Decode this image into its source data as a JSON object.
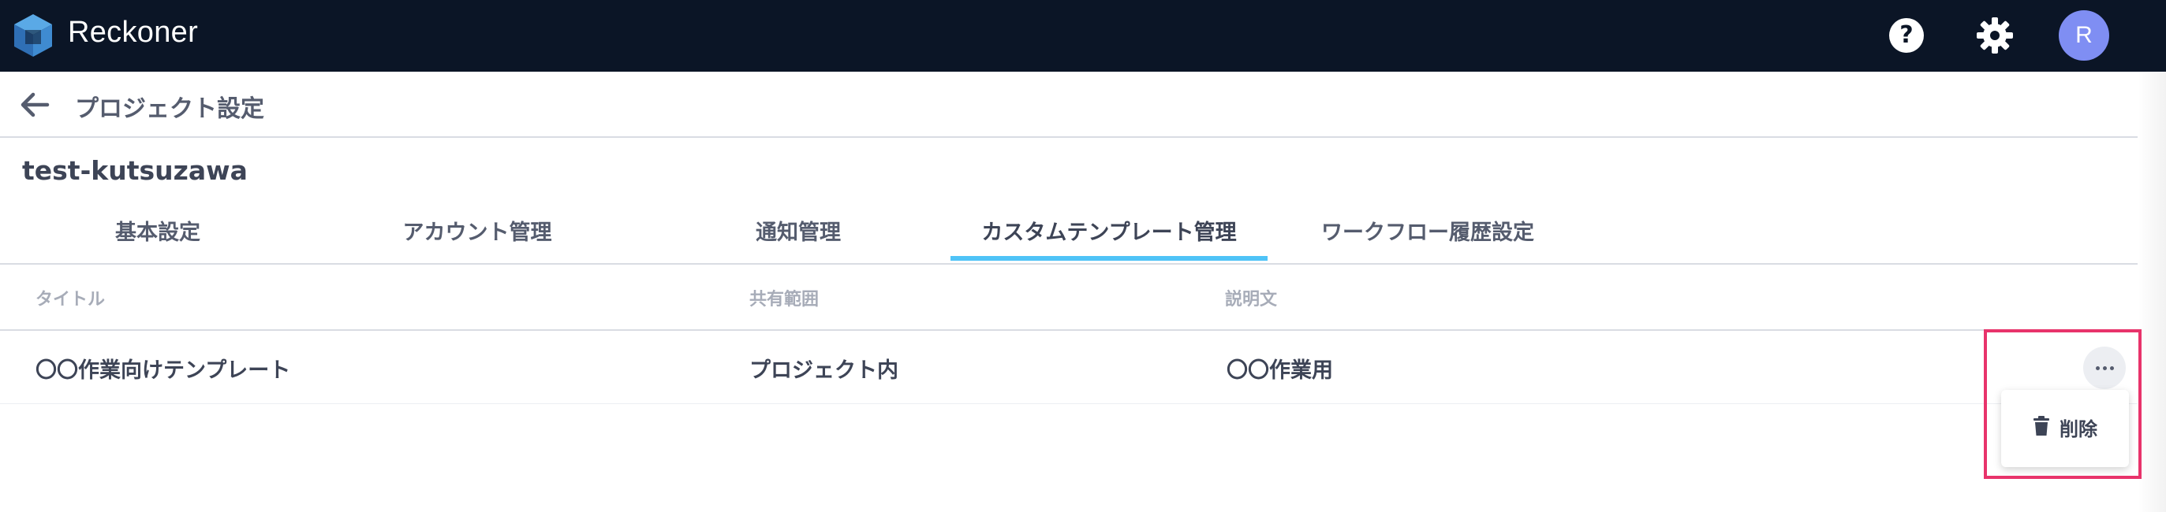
{
  "header": {
    "brand": "Reckoner",
    "help_icon_glyph": "?",
    "avatar_initial": "R",
    "avatar_color": "#7f8ef3",
    "bg_color": "#0b1526"
  },
  "subheader": {
    "title": "プロジェクト設定"
  },
  "project": {
    "name": "test-kutsuzawa"
  },
  "tabs": [
    {
      "label": "基本設定"
    },
    {
      "label": "アカウント管理"
    },
    {
      "label": "通知管理"
    },
    {
      "label": "カスタムテンプレート管理",
      "active": true
    },
    {
      "label": "ワークフロー履歴設定"
    }
  ],
  "table": {
    "columns": [
      "タイトル",
      "共有範囲",
      "説明文"
    ],
    "rows": [
      {
        "title": "〇〇作業向けテンプレート",
        "scope": "プロジェクト内",
        "description": "〇〇作業用"
      }
    ]
  },
  "row_menu": {
    "items": [
      {
        "label": "削除",
        "icon": "trash-icon"
      }
    ]
  },
  "colors": {
    "tab_accent": "#4fc3f7",
    "highlight": "#e8336b"
  }
}
